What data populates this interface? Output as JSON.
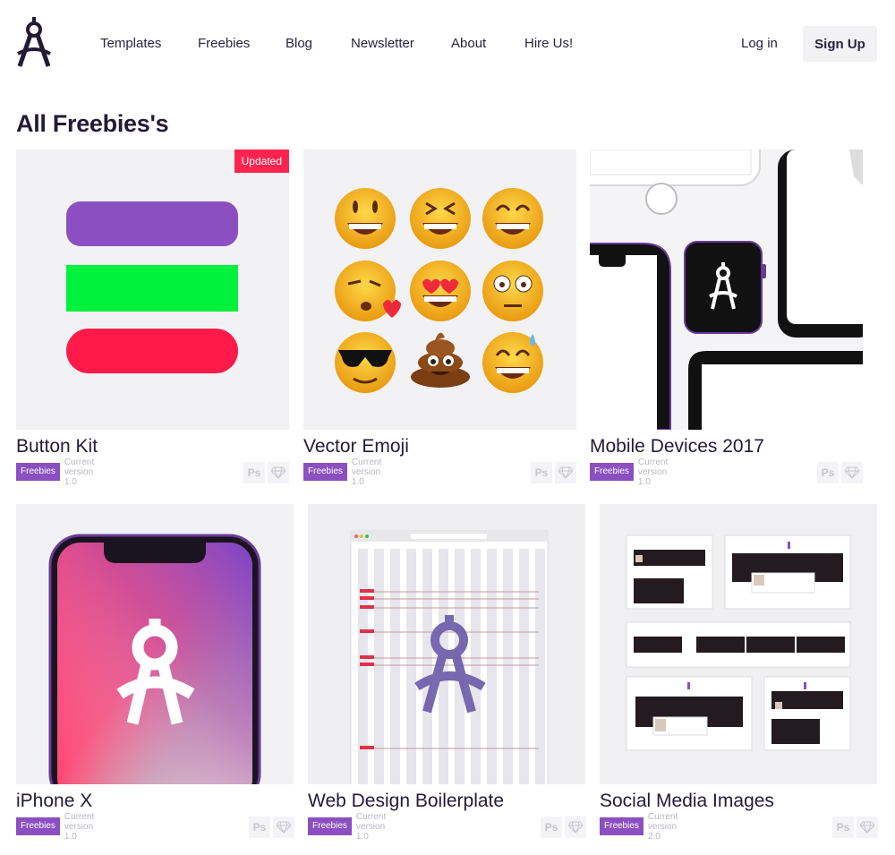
{
  "header": {
    "logo_icon": "compass-icon",
    "nav": [
      "Templates",
      "Freebies",
      "Blog",
      "Newsletter",
      "About",
      "Hire Us!"
    ],
    "login": "Log in",
    "signup": "Sign Up"
  },
  "page_title": "All Freebies's",
  "cards": [
    {
      "title": "Button Kit",
      "badge": "Freebies",
      "version": "Current version 1.0",
      "ribbon": "Updated"
    },
    {
      "title": "Vector Emoji",
      "badge": "Freebies",
      "version": "Current version 1.0"
    },
    {
      "title": "Mobile Devices 2017",
      "badge": "Freebies",
      "version": "Current version 1.0"
    },
    {
      "title": "iPhone X",
      "badge": "Freebies",
      "version": "Current version 1.0"
    },
    {
      "title": "Web Design Boilerplate",
      "badge": "Freebies",
      "version": "Current version 1.0"
    },
    {
      "title": "Social Media Images",
      "badge": "Freebies",
      "version": "Current version 2.0"
    }
  ],
  "file_icons": {
    "ps": "Ps",
    "sketch": "sketch-icon"
  },
  "colors": {
    "accent": "#8b4fc2",
    "ribbon": "#ff2450",
    "button_purple": "#8b4fc2",
    "button_green": "#00f23c",
    "button_red": "#ff1a4a"
  }
}
